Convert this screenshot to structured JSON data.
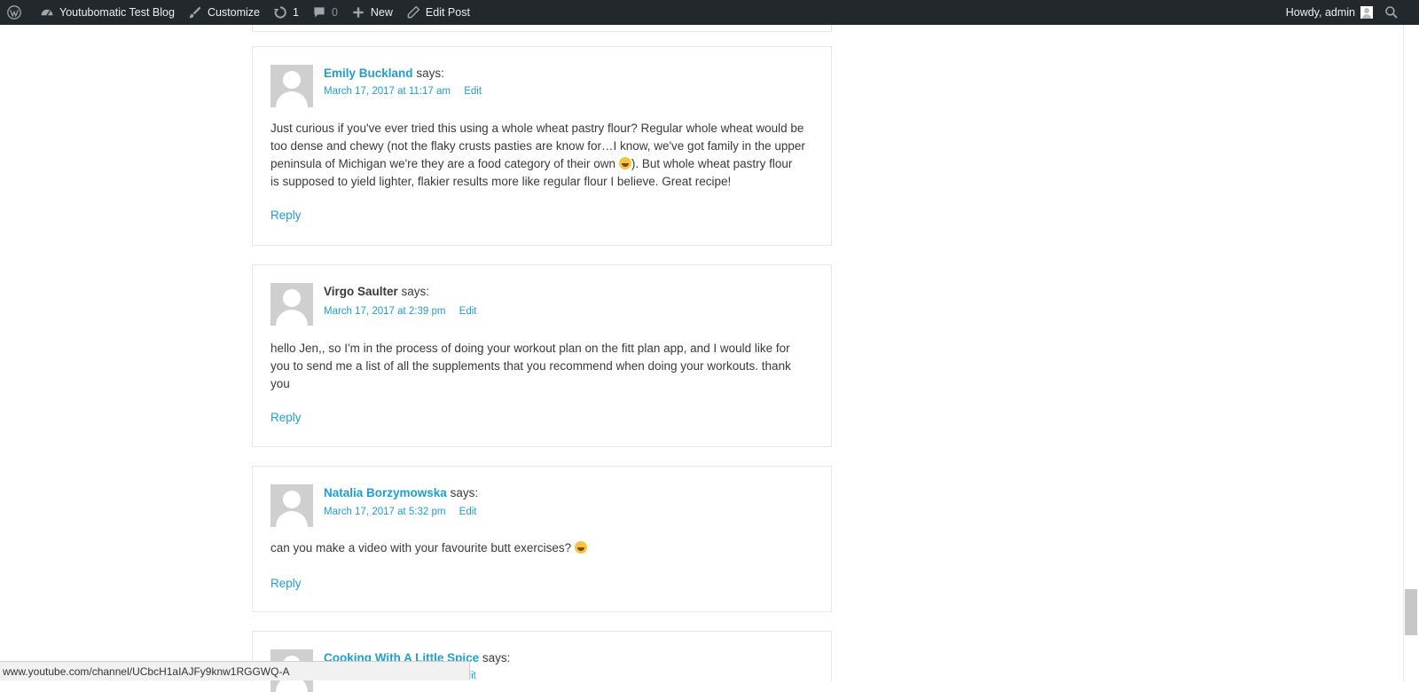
{
  "adminbar": {
    "site_name": "Youtubomatic Test Blog",
    "customize": "Customize",
    "updates_count": "1",
    "comments_count": "0",
    "new_label": "New",
    "edit_post": "Edit Post",
    "howdy": "Howdy, admin"
  },
  "comments": [
    {
      "author": "Emily Buckland",
      "says": "says:",
      "date": "March 17, 2017 at 11:17 am",
      "edit": "Edit",
      "body_lines": [
        "Just curious if you've ever tried this using a whole wheat pastry flour? Regular whole wheat would be",
        "too dense and chewy (not the flaky crusts pasties are know for…I know, we've got family in the upper",
        "peninsula of Michigan we're they are a food category of their own",
        "). But whole wheat pastry flour",
        "is supposed to yield lighter, flakier results more like regular flour I believe. Great recipe!"
      ],
      "reply": "Reply"
    },
    {
      "author": "Virgo Saulter",
      "says": "says:",
      "date": "March 17, 2017 at 2:39 pm",
      "edit": "Edit",
      "body_lines": [
        "hello Jen,, so I'm in the process of doing your workout plan on the fitt plan app, and I would like for",
        "you to send me a list of all the supplements that you recommend when doing your workouts. thank",
        "you"
      ],
      "reply": "Reply"
    },
    {
      "author": "Natalia Borzymowska",
      "says": "says:",
      "date": "March 17, 2017 at 5:32 pm",
      "edit": "Edit",
      "body_lines": [
        "can you make a video with your favourite butt exercises?"
      ],
      "reply": "Reply"
    },
    {
      "author": "Cooking With A Little Spice",
      "says": "says:",
      "edit": "Edit"
    }
  ],
  "statusbar": {
    "url": "www.youtube.com/channel/UCbcH1aIAJFy9knw1RGGWQ-A"
  },
  "colors": {
    "adminbar_bg": "#23282d",
    "link": "#1e9fd1",
    "text": "#3a3a3a",
    "border": "#e6e6e6"
  },
  "icons": [
    "wordpress-icon",
    "dashboard-icon",
    "brush-icon",
    "update-icon",
    "comment-icon",
    "plus-icon",
    "pencil-icon",
    "search-icon"
  ]
}
